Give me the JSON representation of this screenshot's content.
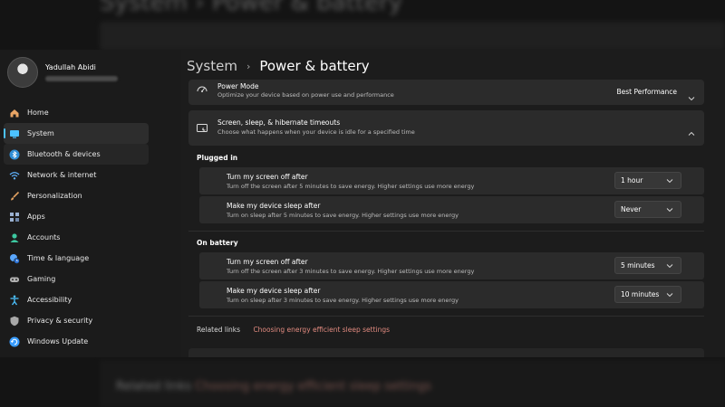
{
  "window": {
    "breadcrumb": {
      "parent": "System",
      "separator": "›",
      "current": "Power & battery"
    }
  },
  "profile": {
    "name": "Yadullah Abidi"
  },
  "sidebar": {
    "items": [
      {
        "label": "Home",
        "icon": "home-icon",
        "color": "#e8a464"
      },
      {
        "label": "System",
        "icon": "system-icon",
        "color": "#4cc2ff",
        "active": true
      },
      {
        "label": "Bluetooth & devices",
        "icon": "bluetooth-icon",
        "color": "#4cc2ff"
      },
      {
        "label": "Network & internet",
        "icon": "wifi-icon",
        "color": "#60b4ff"
      },
      {
        "label": "Personalization",
        "icon": "brush-icon",
        "color": "#e0a060"
      },
      {
        "label": "Apps",
        "icon": "apps-icon",
        "color": "#9ab0d0"
      },
      {
        "label": "Accounts",
        "icon": "accounts-icon",
        "color": "#3cc8a0"
      },
      {
        "label": "Time & language",
        "icon": "globe-clock-icon",
        "color": "#5aa8ff"
      },
      {
        "label": "Gaming",
        "icon": "gamepad-icon",
        "color": "#b0b0b0"
      },
      {
        "label": "Accessibility",
        "icon": "accessibility-icon",
        "color": "#4cc2ff"
      },
      {
        "label": "Privacy & security",
        "icon": "shield-icon",
        "color": "#a8a8a8"
      },
      {
        "label": "Windows Update",
        "icon": "update-icon",
        "color": "#3a9dff"
      }
    ]
  },
  "power_mode": {
    "title": "Power Mode",
    "description": "Optimize your device based on power use and performance",
    "value": "Best Performance"
  },
  "timeouts": {
    "title": "Screen, sleep, & hibernate timeouts",
    "description": "Choose what happens when your device is idle for a specified time",
    "plugged_in": {
      "label": "Plugged in",
      "screen": {
        "title": "Turn my screen off after",
        "description": "Turn off the screen after 5 minutes to save energy. Higher settings use more energy",
        "value": "1 hour"
      },
      "sleep": {
        "title": "Make my device sleep after",
        "description": "Turn on sleep after 5 minutes to save energy. Higher settings use more energy",
        "value": "Never"
      }
    },
    "on_battery": {
      "label": "On battery",
      "screen": {
        "title": "Turn my screen off after",
        "description": "Turn off the screen after 3 minutes to save energy. Higher settings use more energy",
        "value": "5 minutes"
      },
      "sleep": {
        "title": "Make my device sleep after",
        "description": "Turn on sleep after 3 minutes to save energy. Higher settings use more energy",
        "value": "10 minutes"
      }
    }
  },
  "related": {
    "label": "Related links",
    "link": "Choosing energy efficient sleep settings"
  },
  "colors": {
    "accent": "#4cc2ff",
    "link": "#e08a7f",
    "card": "#2b2b2b",
    "window": "#1c1c1c"
  }
}
